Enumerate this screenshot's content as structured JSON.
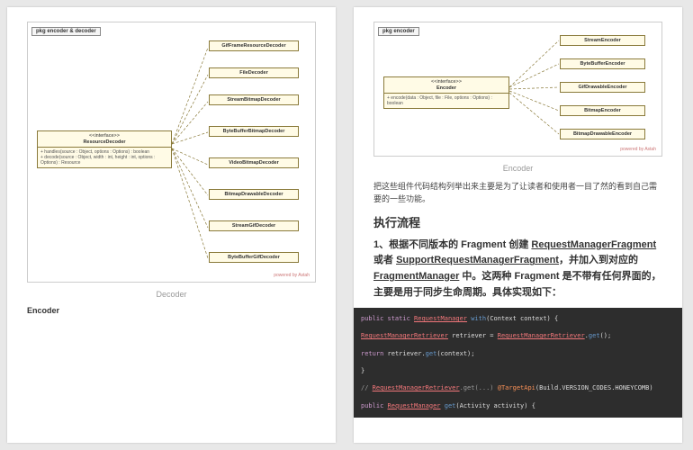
{
  "page1": {
    "pkg": "pkg encoder & decoder",
    "interface": {
      "stereotype": "<<interface>>",
      "name": "ResourceDecoder",
      "methods": "+ handles(source : Object, options : Options) : boolean\n+ decode(source : Object, width : int, height : int, options : Options) : Resource"
    },
    "impls": [
      "GifFrameResourceDecoder",
      "FileDecoder",
      "StreamBitmapDecoder",
      "ByteBufferBitmapDecoder",
      "VideoBitmapDecoder",
      "BitmapDrawableDecoder",
      "StreamGifDecoder",
      "ByteBufferGifDecoder"
    ],
    "powered": "powered by Astah",
    "caption": "Decoder",
    "heading": "Encoder"
  },
  "page2": {
    "pkg": "pkg encoder",
    "interface": {
      "stereotype": "<<interface>>",
      "name": "Encoder",
      "methods": "+ encode(data : Object, file : File, options : Options) : boolean"
    },
    "impls": [
      "StreamEncoder",
      "ByteBufferEncoder",
      "GifDrawableEncoder",
      "BitmapEncoder",
      "BitmapDrawableEncoder"
    ],
    "powered": "powered by Astah",
    "caption": "Encoder",
    "intro": "把这些组件代码结构列举出来主要是为了让读者和使用者一目了然的看到自己需要的一些功能。",
    "h2": "执行流程",
    "h3_pre": "1、根据不同版本的 Fragment 创建 ",
    "h3_u1": "RequestManagerFragment",
    "h3_mid1": " 或者 ",
    "h3_u2": "SupportRequestManagerFragment",
    "h3_mid2": "，并加入到对应的 ",
    "h3_u3": "FragmentManager",
    "h3_post": " 中。这两种 Fragment 是不带有任何界面的，主要是用于同步生命周期。具体实现如下：",
    "code": {
      "l1a": "public static ",
      "l1b": "RequestManager",
      "l1c": " ",
      "l1d": "with",
      "l1e": "(Context context) {",
      "l2a": "RequestManagerRetriever",
      "l2b": " retriever = ",
      "l2c": "RequestManagerRetriever",
      "l2d": ".",
      "l2e": "get",
      "l2f": "();",
      "l3a": "return",
      "l3b": " retriever.",
      "l3c": "get",
      "l3d": "(context);",
      "l4": "}",
      "l5a": "// ",
      "l5b": "RequestManagerRetriever",
      "l5c": ".get(...) ",
      "l5d": "@TargetApi",
      "l5e": "(Build.VERSION_CODES.HONEYCOMB)",
      "l6a": "public ",
      "l6b": "RequestManager",
      "l6c": " ",
      "l6d": "get",
      "l6e": "(Activity activity) {"
    }
  }
}
